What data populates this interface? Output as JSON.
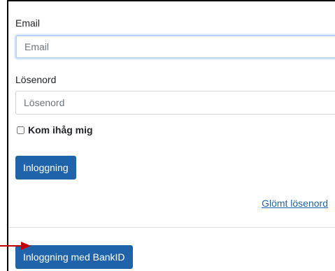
{
  "login": {
    "email_label": "Email",
    "email_placeholder": "Email",
    "password_label": "Lösenord",
    "password_placeholder": "Lösenord",
    "remember_label": "Kom ihåg mig",
    "login_button": "Inloggning",
    "forgot_link": "Glömt lösenord",
    "bankid_button": "Inloggning med BankID"
  },
  "colors": {
    "primary": "#1f64ab",
    "arrow": "#c00000"
  },
  "icons": {
    "annotation": "arrow-right-icon"
  }
}
